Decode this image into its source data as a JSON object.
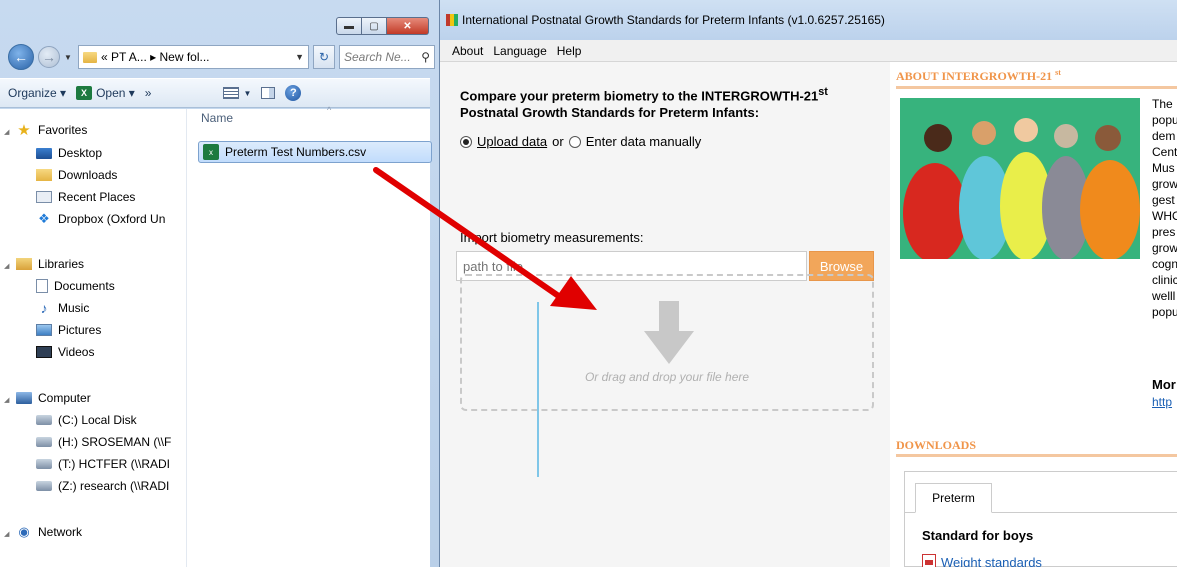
{
  "explorer": {
    "address": "« PT A... ▸ New fol...",
    "search_placeholder": "Search Ne...",
    "toolbar": {
      "organize": "Organize ▾",
      "open": "Open ▾",
      "more": "»"
    },
    "nav_items": {
      "favorites": "Favorites",
      "desktop": "Desktop",
      "downloads": "Downloads",
      "recent_places": "Recent Places",
      "dropbox": "Dropbox (Oxford Un",
      "libraries": "Libraries",
      "documents": "Documents",
      "music": "Music",
      "pictures": "Pictures",
      "videos": "Videos",
      "computer": "Computer",
      "local_disk": "(C:) Local Disk",
      "drive_h": "(H:) SROSEMAN (\\\\F",
      "drive_t": "(T:) HCTFER (\\\\RADI",
      "drive_z": "(Z:) research (\\\\RADI",
      "network": "Network"
    },
    "column_header": "Name",
    "file_name": "Preterm Test Numbers.csv"
  },
  "app": {
    "title": "International Postnatal Growth Standards for Preterm Infants (v1.0.6257.25165)",
    "menu": {
      "about": "About",
      "language": "Language",
      "help": "Help"
    },
    "heading_line1": "Compare your preterm biometry to the INTERGROWTH-21",
    "heading_sup": "st",
    "heading_line2": "Postnatal Growth Standards for Preterm Infants:",
    "upload_link": "Upload data",
    "or_text": "or",
    "manual_option": "Enter data manually",
    "import_label": "Import biometry measurements:",
    "path_placeholder": "path to file",
    "browse": "Browse",
    "drop_text": "Or drag and drop your file here",
    "about_title": "ABOUT INTERGROWTH-21",
    "about_sup": "st",
    "about_lines": [
      "The",
      "popu",
      "dem",
      "Cent",
      "Mus",
      "grow",
      "gest",
      "WHO",
      "pres",
      "grow",
      "cogn",
      "clinic",
      "welll",
      "popu"
    ],
    "more": "Mor",
    "more_link": "http",
    "downloads_title": "DOWNLOADS",
    "tab_preterm": "Preterm",
    "standard_boys": "Standard for boys",
    "weight_standards": "Weight standards"
  },
  "colors": {
    "accent_orange": "#f2a65a",
    "section_title": "#f0954a",
    "annotation_arrow": "#e00000"
  }
}
